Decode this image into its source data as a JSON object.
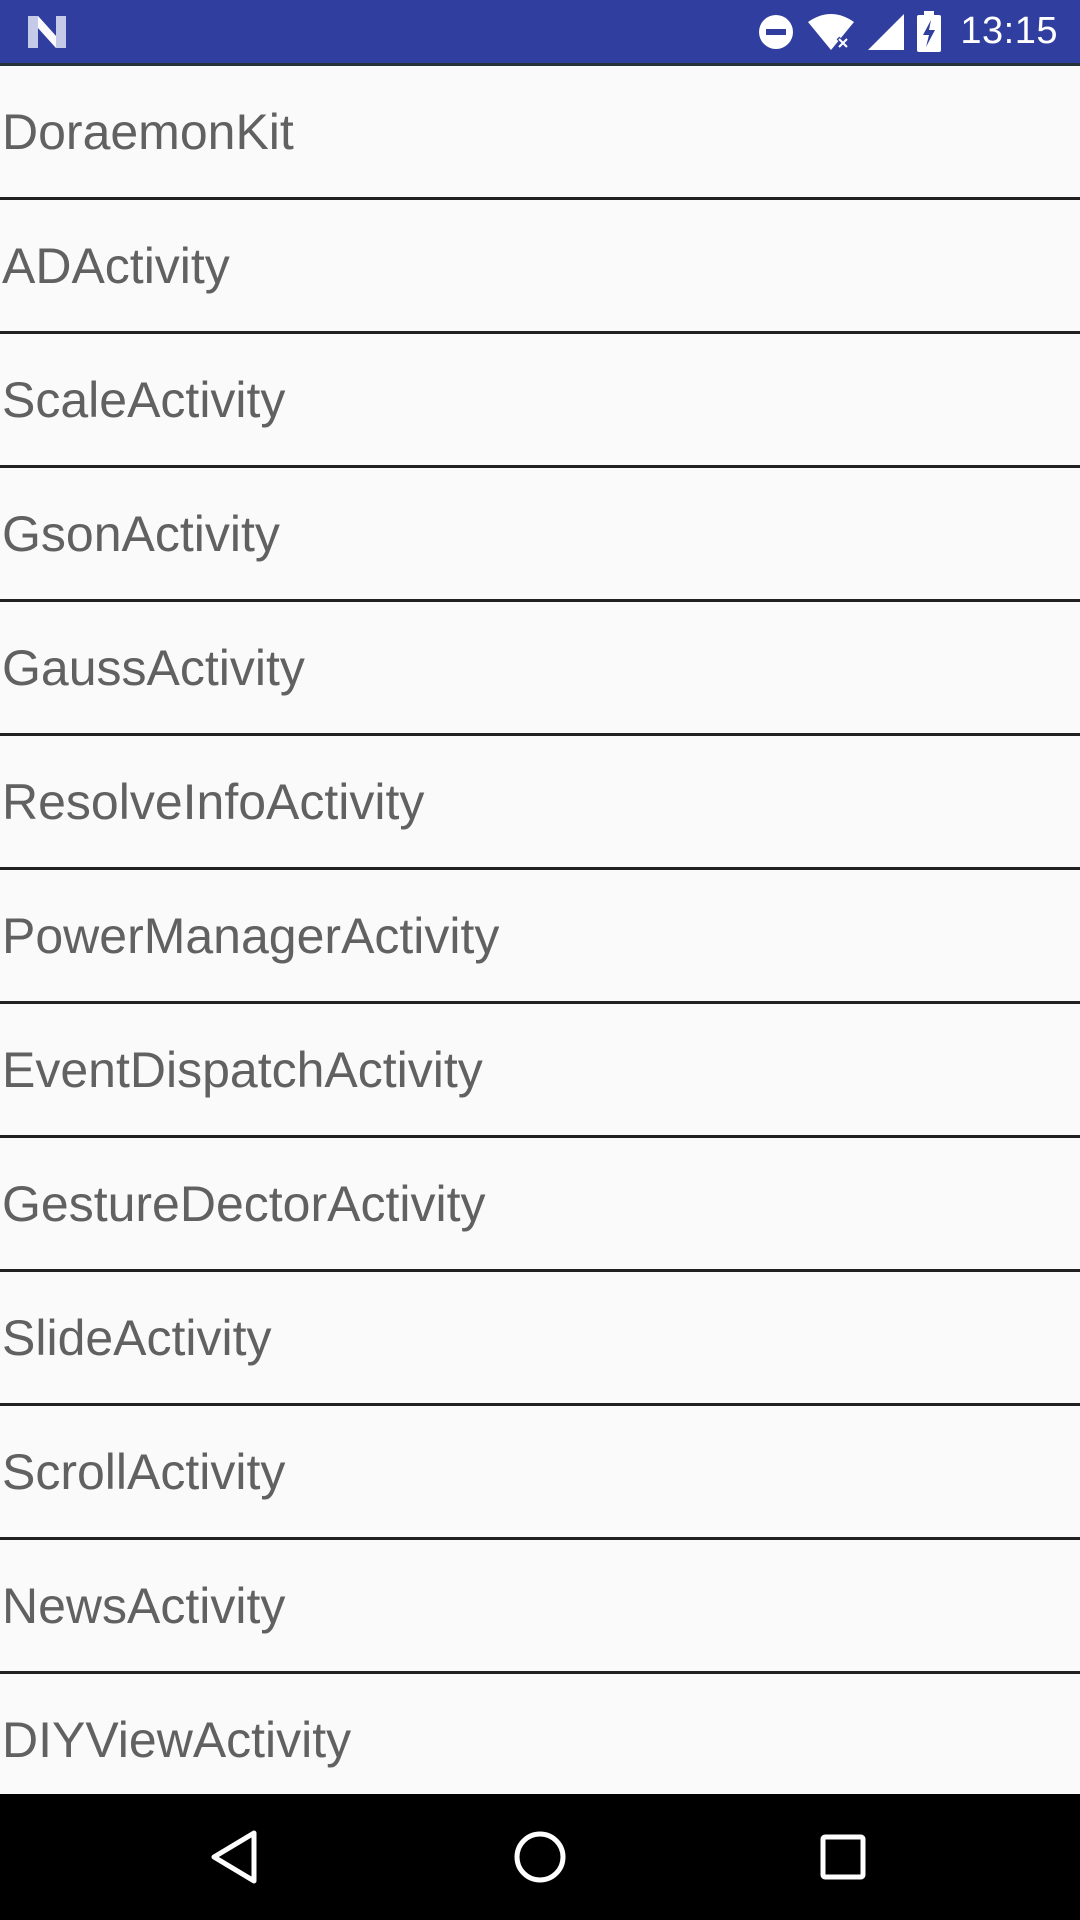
{
  "status_bar": {
    "time": "13:15",
    "icons": [
      "n-logo-icon",
      "do-not-disturb-icon",
      "wifi-icon",
      "cell-signal-icon",
      "battery-charging-icon"
    ]
  },
  "list": {
    "items": [
      {
        "label": "DoraemonKit"
      },
      {
        "label": "ADActivity"
      },
      {
        "label": "ScaleActivity"
      },
      {
        "label": "GsonActivity"
      },
      {
        "label": "GaussActivity"
      },
      {
        "label": "ResolveInfoActivity"
      },
      {
        "label": "PowerManagerActivity"
      },
      {
        "label": "EventDispatchActivity"
      },
      {
        "label": "GestureDectorActivity"
      },
      {
        "label": "SlideActivity"
      },
      {
        "label": "ScrollActivity"
      },
      {
        "label": "NewsActivity"
      },
      {
        "label": "DIYViewActivity"
      }
    ]
  },
  "nav_bar": {
    "buttons": [
      "back-icon",
      "home-icon",
      "recents-icon"
    ]
  },
  "colors": {
    "status_bar": "#303f9f",
    "background": "#fafafa",
    "text": "#616161",
    "divider": "#212121",
    "nav_bar": "#000000"
  }
}
